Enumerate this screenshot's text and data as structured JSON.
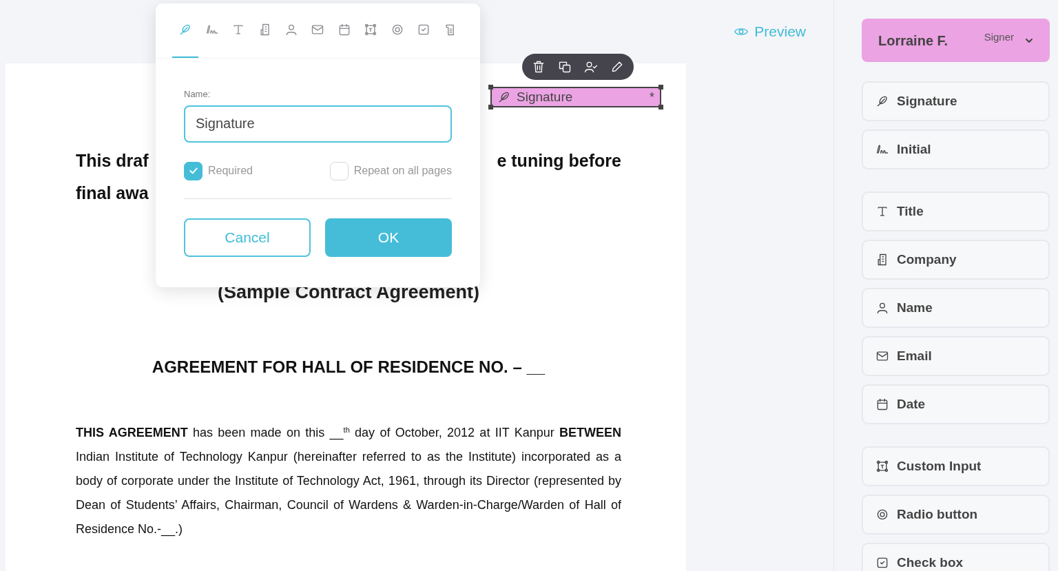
{
  "preview_link": "Preview",
  "document": {
    "heading_lines": [
      {
        "left": "This draf",
        "right": "e tuning before"
      },
      {
        "left": "final awa"
      }
    ],
    "subtitle": "(Sample Contract Agreement)",
    "title": "AGREEMENT FOR HALL OF RESIDENCE NO. – __",
    "paragraph": "**THIS AGREEMENT** has been made on this __$^{th}$ day of October, 2012 at IIT Kanpur **BETWEEN** Indian Institute of Technology Kanpur (hereinafter referred to as the Institute) incorporated as a body of corporate under the Institute of Technology Act, 1961, through its Director (represented by Dean of Students’ Affairs, Chairman, Council of Wardens & Warden-in-Charge/Warden of Hall of Residence No.-__.)"
  },
  "placed_field": {
    "label": "Signature",
    "required_mark": "*",
    "kind": "signature",
    "selected": true
  },
  "field_toolbar": [
    {
      "kind": "delete"
    },
    {
      "kind": "copy"
    },
    {
      "kind": "assign"
    },
    {
      "kind": "edit"
    }
  ],
  "field_dialog": {
    "tabs": [
      {
        "kind": "signature",
        "selected": true
      },
      {
        "kind": "initial",
        "selected": false
      },
      {
        "kind": "title",
        "selected": false
      },
      {
        "kind": "company",
        "selected": false
      },
      {
        "kind": "name",
        "selected": false
      },
      {
        "kind": "email",
        "selected": false
      },
      {
        "kind": "date",
        "selected": false
      },
      {
        "kind": "custom",
        "selected": false
      },
      {
        "kind": "radio",
        "selected": false
      },
      {
        "kind": "checkbox",
        "selected": false
      },
      {
        "kind": "stamp",
        "selected": false
      }
    ],
    "name_label": "Name:",
    "name_value": "Signature",
    "options": [
      {
        "label": "Required",
        "checked": true
      },
      {
        "label": "Repeat on all pages",
        "checked": false
      }
    ],
    "cancel": "Cancel",
    "ok": "OK"
  },
  "sidebar": {
    "signer": {
      "name": "Lorraine F.",
      "role": "Signer"
    },
    "groups": [
      [
        {
          "kind": "signature",
          "label": "Signature"
        },
        {
          "kind": "initial",
          "label": "Initial"
        }
      ],
      [
        {
          "kind": "title",
          "label": "Title"
        },
        {
          "kind": "company",
          "label": "Company"
        },
        {
          "kind": "name",
          "label": "Name"
        },
        {
          "kind": "email",
          "label": "Email"
        },
        {
          "kind": "date",
          "label": "Date"
        }
      ],
      [
        {
          "kind": "custom",
          "label": "Custom Input"
        },
        {
          "kind": "radio",
          "label": "Radio button"
        },
        {
          "kind": "checkbox",
          "label": "Check box"
        }
      ]
    ]
  }
}
